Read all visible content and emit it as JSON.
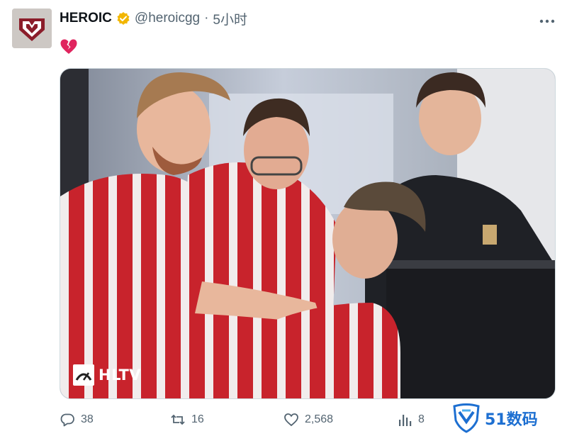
{
  "author": {
    "name": "HEROIC",
    "handle": "@heroicgg",
    "separator": "·",
    "time": "5小时",
    "avatar_icon": "heroic-logo",
    "verified_icon": "gold-verified-badge"
  },
  "tweet": {
    "text_icon": "broken-heart-emoji"
  },
  "media": {
    "description_icon": "photo-players-celebrating",
    "watermark": "HLTV"
  },
  "actions": {
    "replies": "38",
    "retweets": "16",
    "likes": "2,568",
    "views": "8"
  },
  "overlay": {
    "site_watermark": "51数码"
  },
  "colors": {
    "accent_gold": "#f2b600",
    "muted": "#536471",
    "jersey_red": "#c8232c",
    "site_blue": "#1d6fd1"
  }
}
